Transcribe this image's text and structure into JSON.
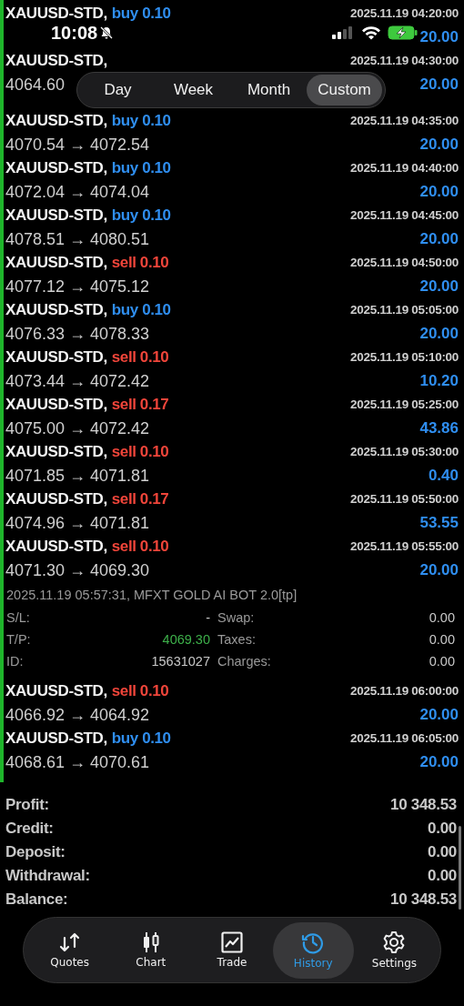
{
  "status_bar": {
    "time": "10:08"
  },
  "period_tabs": [
    {
      "label": "Day",
      "selected": false
    },
    {
      "label": "Week",
      "selected": false
    },
    {
      "label": "Month",
      "selected": false
    },
    {
      "label": "Custom",
      "selected": true
    }
  ],
  "deals": [
    {
      "kind": "trade",
      "symbol": "XAUUSD-STD,",
      "side": "buy",
      "volume": "0.10",
      "time": "2025.11.19 04:20:00",
      "profit": "20.00"
    },
    {
      "kind": "trade",
      "symbol": "XAUUSD-STD,",
      "time": "2025.11.19 04:30:00",
      "prices": "4064.60",
      "profit": "20.00"
    },
    {
      "kind": "trade",
      "symbol": "XAUUSD-STD,",
      "side": "buy",
      "volume": "0.10",
      "time": "2025.11.19 04:35:00",
      "prices": "4070.54 → 4072.54",
      "profit": "20.00"
    },
    {
      "kind": "trade",
      "symbol": "XAUUSD-STD,",
      "side": "buy",
      "volume": "0.10",
      "time": "2025.11.19 04:40:00",
      "prices": "4072.04 → 4074.04",
      "profit": "20.00"
    },
    {
      "kind": "trade",
      "symbol": "XAUUSD-STD,",
      "side": "buy",
      "volume": "0.10",
      "time": "2025.11.19 04:45:00",
      "prices": "4078.51 → 4080.51",
      "profit": "20.00"
    },
    {
      "kind": "trade",
      "symbol": "XAUUSD-STD,",
      "side": "sell",
      "volume": "0.10",
      "time": "2025.11.19 04:50:00",
      "prices": "4077.12 → 4075.12",
      "profit": "20.00"
    },
    {
      "kind": "trade",
      "symbol": "XAUUSD-STD,",
      "side": "buy",
      "volume": "0.10",
      "time": "2025.11.19 05:05:00",
      "prices": "4076.33 → 4078.33",
      "profit": "20.00"
    },
    {
      "kind": "trade",
      "symbol": "XAUUSD-STD,",
      "side": "sell",
      "volume": "0.10",
      "time": "2025.11.19 05:10:00",
      "prices": "4073.44 → 4072.42",
      "profit": "10.20"
    },
    {
      "kind": "trade",
      "symbol": "XAUUSD-STD,",
      "side": "sell",
      "volume": "0.17",
      "time": "2025.11.19 05:25:00",
      "prices": "4075.00 → 4072.42",
      "profit": "43.86"
    },
    {
      "kind": "trade",
      "symbol": "XAUUSD-STD,",
      "side": "sell",
      "volume": "0.10",
      "time": "2025.11.19 05:30:00",
      "prices": "4071.85 → 4071.81",
      "profit": "0.40"
    },
    {
      "kind": "trade",
      "symbol": "XAUUSD-STD,",
      "side": "sell",
      "volume": "0.17",
      "time": "2025.11.19 05:50:00",
      "prices": "4074.96 → 4071.81",
      "profit": "53.55"
    },
    {
      "kind": "trade",
      "symbol": "XAUUSD-STD,",
      "side": "sell",
      "volume": "0.10",
      "time": "2025.11.19 05:55:00",
      "prices": "4071.30 → 4069.30",
      "profit": "20.00"
    },
    {
      "kind": "detail",
      "comment": "2025.11.19 05:57:31, MFXT GOLD AI BOT 2.0[tp]",
      "left": [
        {
          "label": "S/L:",
          "value": "-",
          "highlight": false
        },
        {
          "label": "T/P:",
          "value": "4069.30",
          "highlight": true
        },
        {
          "label": "ID:",
          "value": "15631027",
          "highlight": false
        }
      ],
      "right": [
        {
          "label": "Swap:",
          "value": "0.00"
        },
        {
          "label": "Taxes:",
          "value": "0.00"
        },
        {
          "label": "Charges:",
          "value": "0.00"
        }
      ]
    },
    {
      "kind": "trade",
      "symbol": "XAUUSD-STD,",
      "side": "sell",
      "volume": "0.10",
      "time": "2025.11.19 06:00:00",
      "prices": "4066.92 → 4064.92",
      "profit": "20.00"
    },
    {
      "kind": "trade",
      "symbol": "XAUUSD-STD,",
      "side": "buy",
      "volume": "0.10",
      "time": "2025.11.19 06:05:00",
      "prices": "4068.61 → 4070.61",
      "profit": "20.00"
    }
  ],
  "summary": [
    {
      "label": "Profit:",
      "value": "10 348.53"
    },
    {
      "label": "Credit:",
      "value": "0.00"
    },
    {
      "label": "Deposit:",
      "value": "0.00"
    },
    {
      "label": "Withdrawal:",
      "value": "0.00"
    },
    {
      "label": "Balance:",
      "value": "10 348.53"
    }
  ],
  "tab_bar": [
    {
      "label": "Quotes",
      "selected": false
    },
    {
      "label": "Chart",
      "selected": false
    },
    {
      "label": "Trade",
      "selected": false
    },
    {
      "label": "History",
      "selected": true
    },
    {
      "label": "Settings",
      "selected": false
    }
  ]
}
